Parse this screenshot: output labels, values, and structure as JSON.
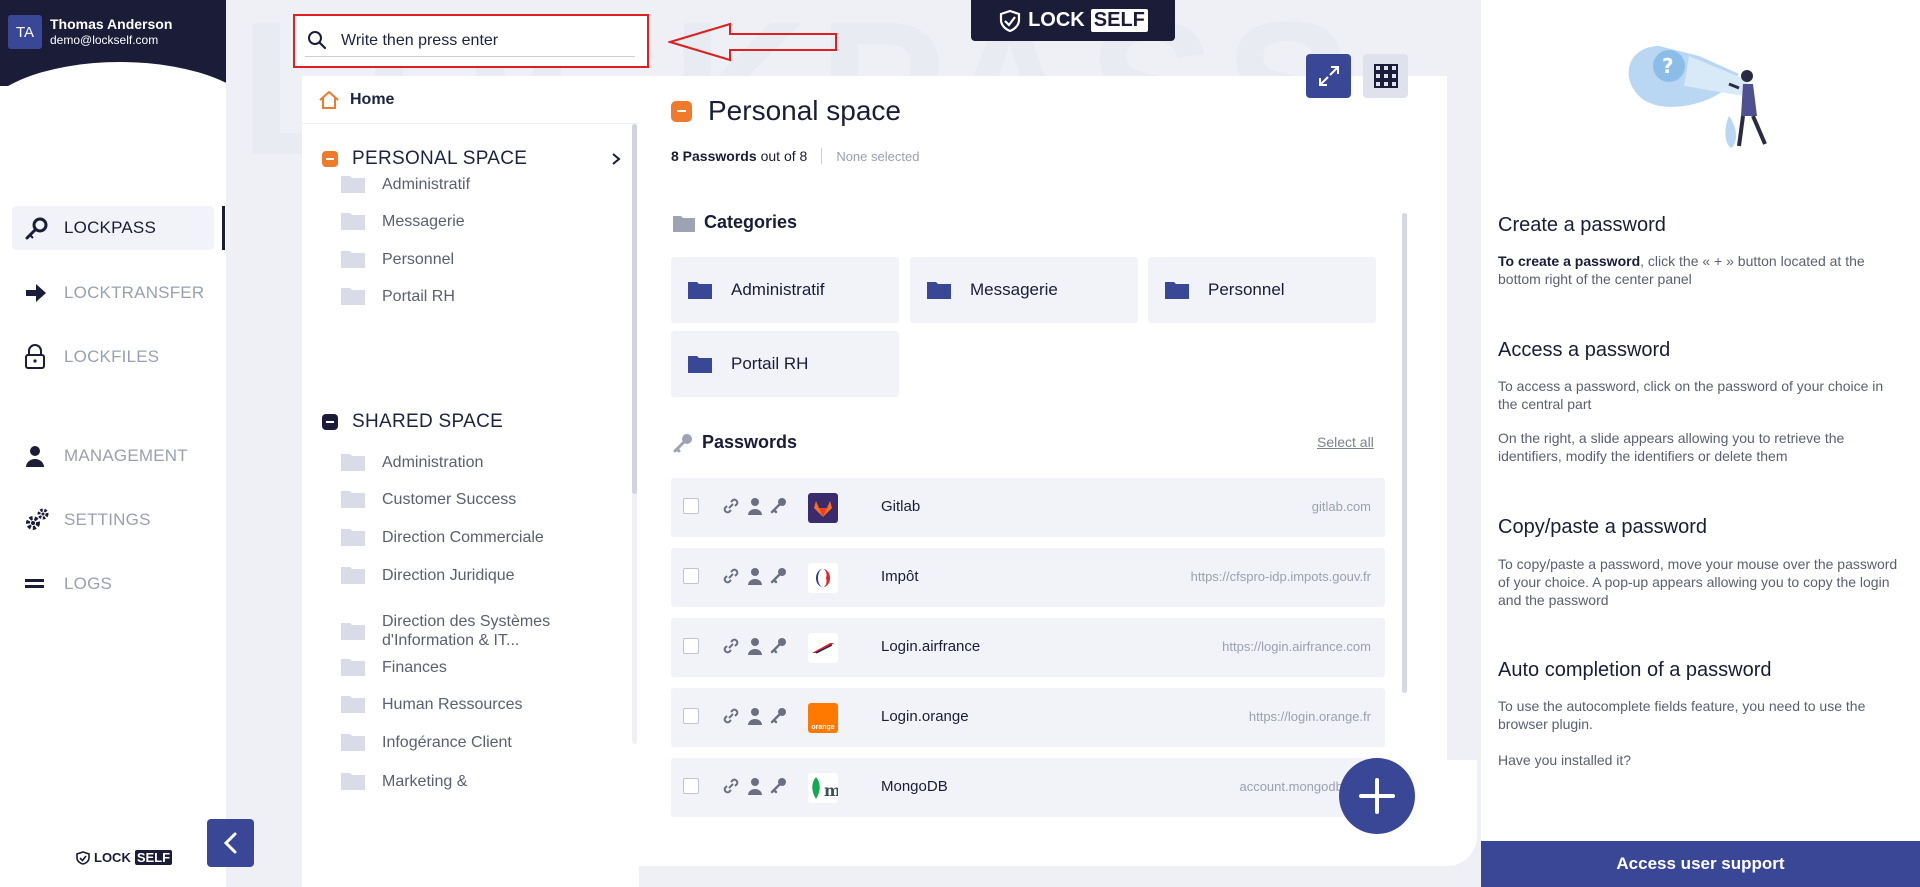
{
  "user": {
    "initials": "TA",
    "name": "Thomas Anderson",
    "email": "demo@lockself.com"
  },
  "nav": {
    "items": [
      {
        "label": "LOCKPASS",
        "icon": "lockpass-icon",
        "active": true
      },
      {
        "label": "LOCKTRANSFER",
        "icon": "arrow-right-icon",
        "active": false
      },
      {
        "label": "LOCKFILES",
        "icon": "lock-icon",
        "active": false
      },
      {
        "label": "MANAGEMENT",
        "icon": "user-icon",
        "active": false
      },
      {
        "label": "SETTINGS",
        "icon": "gears-icon",
        "active": false
      },
      {
        "label": "LOGS",
        "icon": "logs-icon",
        "active": false
      }
    ],
    "logo_lock": "LOCK",
    "logo_self": "SELF"
  },
  "watermark": "LOCKPASS",
  "search": {
    "placeholder": "Write then press enter",
    "value": ""
  },
  "top_logo": {
    "lock": "LOCK",
    "self": "SELF"
  },
  "tree": {
    "home": "Home",
    "personal": {
      "title": "PERSONAL SPACE",
      "color": "#f07a2c",
      "items": [
        "Administratif",
        "Messagerie",
        "Personnel",
        "Portail RH"
      ]
    },
    "shared": {
      "title": "SHARED SPACE",
      "color": "#1a1c38",
      "items": [
        "Administration",
        "Customer Success",
        "Direction Commerciale",
        "Direction Juridique",
        "Direction des Systèmes d'Information & IT...",
        "Finances",
        "Human Ressources",
        "Infogérance Client",
        "Marketing &"
      ]
    }
  },
  "main": {
    "title": "Personal space",
    "count_bold": "8 Passwords",
    "count_rest": "out of 8",
    "selection": "None selected",
    "categories_title": "Categories",
    "categories": [
      "Administratif",
      "Messagerie",
      "Personnel",
      "Portail RH"
    ],
    "passwords_title": "Passwords",
    "select_all": "Select all",
    "passwords": [
      {
        "name": "Gitlab",
        "url": "gitlab.com",
        "logo": "gitlab-icon",
        "logo_bg": "#3c2b6b",
        "logo_text": ""
      },
      {
        "name": "Impôt",
        "url": "https://cfspro-idp.impots.gouv.fr",
        "logo": "impots-icon",
        "logo_bg": "#ffffff",
        "logo_text": ""
      },
      {
        "name": "Login.airfrance",
        "url": "https://login.airfrance.com",
        "logo": "airfrance-icon",
        "logo_bg": "#ffffff",
        "logo_text": ""
      },
      {
        "name": "Login.orange",
        "url": "https://login.orange.fr",
        "logo": "orange-icon",
        "logo_bg": "#ff7900",
        "logo_text": "orange"
      },
      {
        "name": "MongoDB",
        "url": "account.mongodb.com",
        "logo": "mongodb-icon",
        "logo_bg": "#ffffff",
        "logo_text": ""
      }
    ]
  },
  "help": {
    "sections": [
      {
        "title": "Create a password",
        "bold": "To create a password",
        "text": ", click the « + » button located at the bottom right of the center panel"
      },
      {
        "title": "Access a password",
        "text": "To access a password, click on the password of your choice in the central part",
        "text2": "On the right, a slide appears allowing you to retrieve the identifiers, modify the identifiers or delete them"
      },
      {
        "title": "Copy/paste a password",
        "text": "To copy/paste a password, move your mouse over the password of your choice. A pop-up appears allowing you to copy the login and the password"
      },
      {
        "title": "Auto completion of a password",
        "text": "To use the autocomplete fields feature, you need to use the browser plugin.",
        "text2": "Have you installed it?"
      }
    ],
    "support": "Access user support"
  },
  "colors": {
    "navy": "#1a1c38",
    "primary": "#3a4796",
    "orange": "#f07a2c",
    "annotation_red": "#e02020"
  }
}
